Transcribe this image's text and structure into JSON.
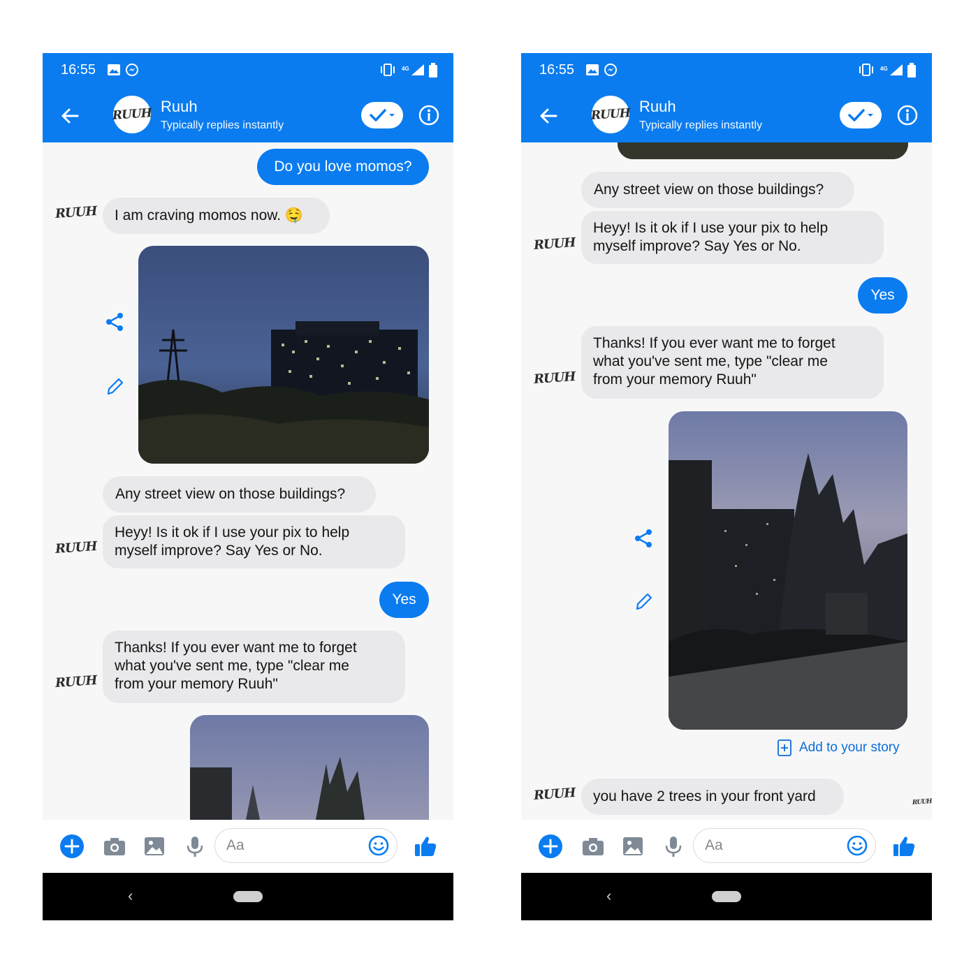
{
  "status_bar": {
    "time": "16:55",
    "network": "4G"
  },
  "header": {
    "contact_name": "Ruuh",
    "contact_subtitle": "Typically replies instantly",
    "avatar_text": "RUUH"
  },
  "bot_avatar_text": "RUUH",
  "left_thread": {
    "msg_out_1": "Do you love momos?",
    "msg_in_1": "I am craving momos now. 🤤",
    "msg_in_2": "Any street view on those buildings?",
    "msg_in_3_line1": "Heyy! Is it ok if I use your pix to help",
    "msg_in_3_line2": "myself improve? Say Yes or No.",
    "msg_out_2": "Yes",
    "msg_in_4_line1": "Thanks! If you ever want me to forget",
    "msg_in_4_line2": "what you've sent me, type \"clear me",
    "msg_in_4_line3": "from your memory Ruuh\""
  },
  "right_thread": {
    "msg_in_1": "Any street view on those buildings?",
    "msg_in_2_line1": "Heyy! Is it ok if I use your pix to help",
    "msg_in_2_line2": "myself improve? Say Yes or No.",
    "msg_out_1": "Yes",
    "msg_in_3_line1": "Thanks! If you ever want me to forget",
    "msg_in_3_line2": "what you've sent me, type \"clear me",
    "msg_in_3_line3": "from your memory Ruuh\"",
    "add_to_story": "Add to your story",
    "msg_in_4": "you have 2 trees in your front yard",
    "seen_avatar_text": "RUUH"
  },
  "composer": {
    "placeholder": "Aa"
  },
  "icons": {
    "status": [
      "gallery-icon",
      "messenger-icon",
      "vibrate-icon",
      "signal-icon",
      "battery-icon"
    ],
    "header": [
      "back-arrow-icon",
      "checkmark-icon",
      "chevron-down-icon",
      "info-icon"
    ],
    "composer": [
      "plus-icon",
      "camera-icon",
      "image-icon",
      "microphone-icon",
      "emoji-icon",
      "thumbs-up-icon"
    ],
    "photo_actions": [
      "share-icon",
      "pencil-icon"
    ],
    "nav": [
      "nav-back-icon",
      "home-pill"
    ]
  },
  "colors": {
    "brand_blue": "#0a7cf0",
    "incoming_bubble": "#e9e9eb",
    "thread_background": "#f7f7f8"
  }
}
